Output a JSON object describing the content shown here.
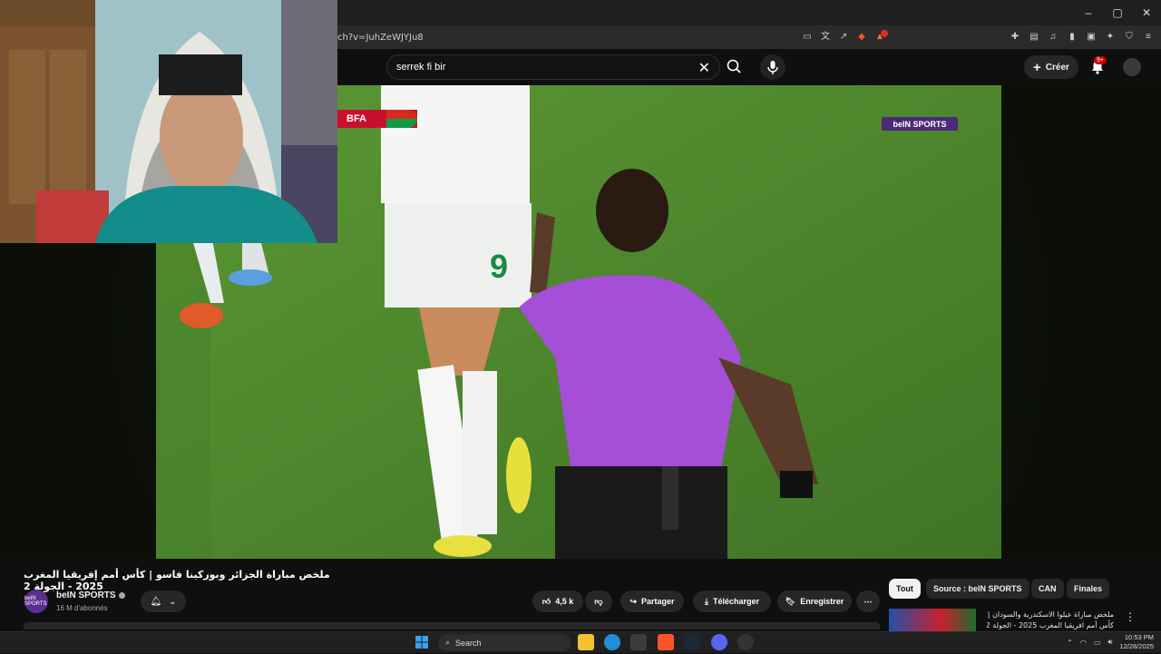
{
  "browser": {
    "url": "ch?v=JuhZeWJYJu8",
    "window_controls": [
      "–",
      "▢",
      "✕"
    ]
  },
  "youtube": {
    "search_query": "serrek fi bir",
    "create_label": "Créer",
    "notification_count": "9+"
  },
  "video": {
    "score_tag": "BFA",
    "broadcaster_logo": "beIN SPORTS",
    "title": "ملخص مباراة الجزائر وبوركينا فاسو | كأس أمم إفريقيا المغرب 2025 - الجولة 2",
    "channel": {
      "name": "beIN SPORTS",
      "subscribers": "16 M d'abonnés",
      "avatar_label": "beIN SPORTS"
    },
    "actions": {
      "likes": "4,5 k",
      "share": "Partager",
      "download": "Télécharger",
      "save": "Enregistrer"
    }
  },
  "chips": [
    "Tout",
    "Source : beIN SPORTS",
    "CAN",
    "Finales"
  ],
  "recommendation": {
    "title_line1": "ملخص مباراة  عيلوا الاسكندرية والسودان |",
    "title_line2": "كأس أمم افريقيا المغرب 2025 - الجولة 2"
  },
  "taskbar": {
    "search_label": "Search",
    "time": "10:53 PM",
    "date": "12/28/2025"
  },
  "colors": {
    "pitch": "#4f8a2c",
    "referee_shirt": "#a54fd6",
    "youtube_red": "#cc0000",
    "bein_purple": "#4b2a78"
  }
}
